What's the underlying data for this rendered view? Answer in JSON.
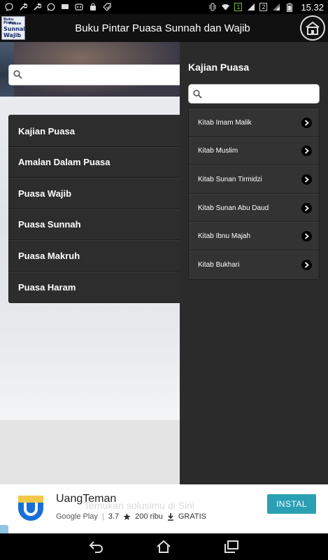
{
  "status_bar": {
    "time": "15.32",
    "sim1": "1",
    "sim2": "2"
  },
  "app_bar": {
    "logo_text": [
      "Buku Pintar",
      "Puasa",
      "Sunnah",
      "Wajib"
    ],
    "title": "Buku Pintar Puasa Sunnah dan Wajib"
  },
  "main": {
    "search_placeholder": "",
    "menu_items": [
      {
        "label": "Kajian Puasa"
      },
      {
        "label": "Amalan Dalam Puasa"
      },
      {
        "label": "Puasa Wajib"
      },
      {
        "label": "Puasa Sunnah"
      },
      {
        "label": "Puasa Makruh"
      },
      {
        "label": "Puasa Haram"
      }
    ]
  },
  "panel": {
    "title": "Kajian Puasa",
    "search_placeholder": "",
    "items": [
      {
        "label": "Kitab Imam Malik"
      },
      {
        "label": "Kitab Muslim"
      },
      {
        "label": "Kitab Sunan Tirmidzi"
      },
      {
        "label": "Kitab Sunan Abu Daud"
      },
      {
        "label": "Kitab Ibnu Majah"
      },
      {
        "label": "Kitab Bukhari"
      }
    ]
  },
  "ad": {
    "app_name": "UangTeman",
    "ghost_text": "Temukan solusimu di Sini",
    "store": "Google Play",
    "rating": "3.7",
    "downloads": "200 ribu",
    "price": "GRATIS",
    "button_label": "INSTAL",
    "accent_color": "#2ba0b4"
  },
  "colors": {
    "panel_bg": "#2b2b2b",
    "menu_bg": "#2d2d2d"
  }
}
